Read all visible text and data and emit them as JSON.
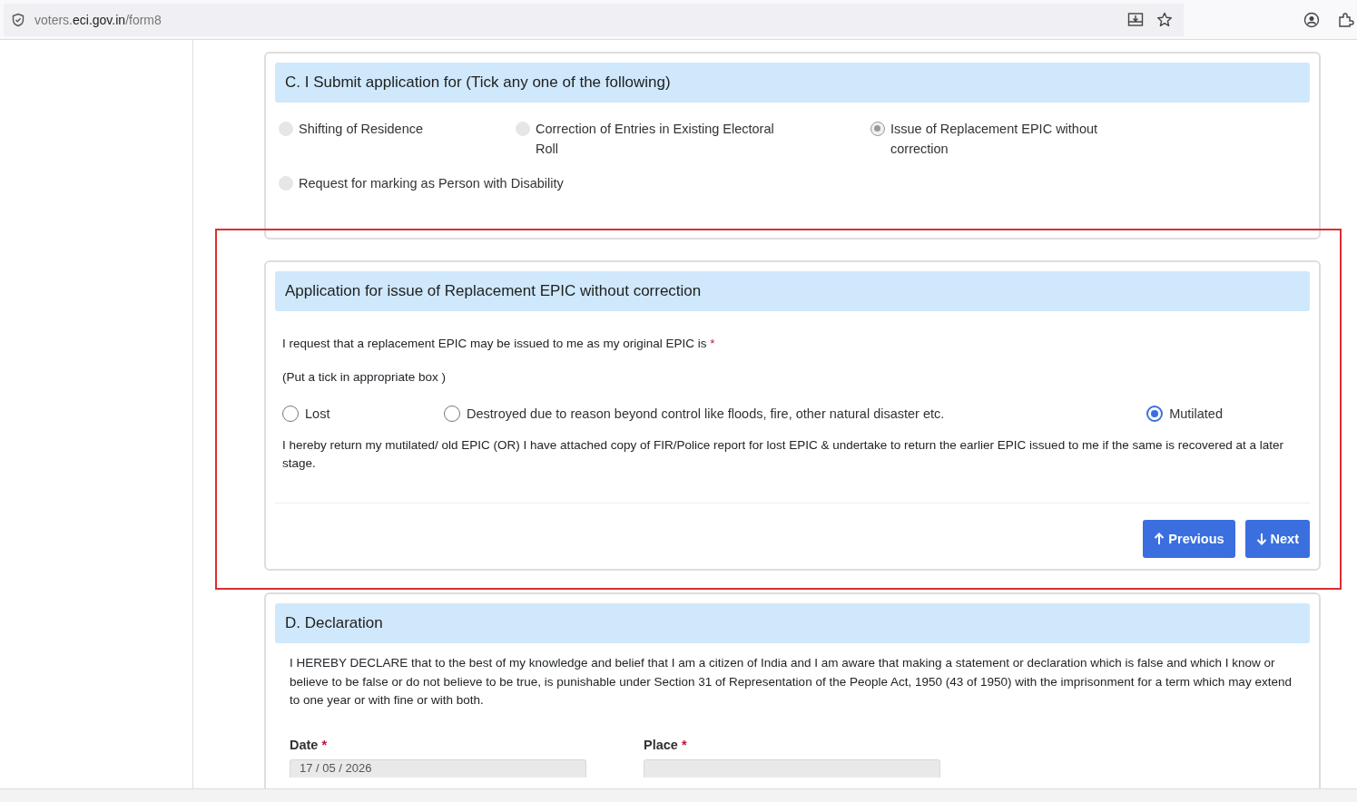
{
  "browser": {
    "url_prefix": "voters.",
    "url_host": "eci.gov.in",
    "url_path": "/form8"
  },
  "section_c": {
    "title": "C. I Submit application for (Tick any one of the following)",
    "options": [
      {
        "label": "Shifting of Residence",
        "selected": false
      },
      {
        "label": "Correction of Entries in Existing Electoral Roll",
        "selected": false
      },
      {
        "label": "Issue of Replacement EPIC without correction",
        "selected": true
      },
      {
        "label": "Request for marking as Person with Disability",
        "selected": false
      }
    ]
  },
  "replacement": {
    "title": "Application for issue of Replacement EPIC without correction",
    "prompt": "I request that a replacement EPIC may be issued to me as my original EPIC is",
    "required_mark": "*",
    "hint": "(Put a tick in appropriate box )",
    "options": [
      {
        "label": "Lost",
        "selected": false
      },
      {
        "label": "Destroyed due to reason beyond control like floods, fire, other natural disaster etc.",
        "selected": false
      },
      {
        "label": "Mutilated",
        "selected": true
      }
    ],
    "undertaking": "I hereby return my mutilated/ old EPIC (OR) I have attached copy of FIR/Police report for lost EPIC & undertake to return the earlier EPIC issued to me if the same is recovered at a later stage.",
    "buttons": [
      {
        "label": "Previous",
        "kind": "previous"
      },
      {
        "label": "Next",
        "kind": "next"
      }
    ]
  },
  "declaration": {
    "title": "D. Declaration",
    "text": "I HEREBY DECLARE that to the best of my knowledge and belief that I am a citizen of India and I am aware that making a statement or declaration which is false and which I know or believe to be false or do not believe to be true, is punishable under Section 31 of Representation of the People Act, 1950 (43 of 1950) with the imprisonment for a term which may extend to one year or with fine or with both.",
    "fields": [
      {
        "label": "Date",
        "required_mark": "*",
        "value": "17 / 05 / 2026"
      },
      {
        "label": "Place",
        "required_mark": "*"
      }
    ]
  }
}
